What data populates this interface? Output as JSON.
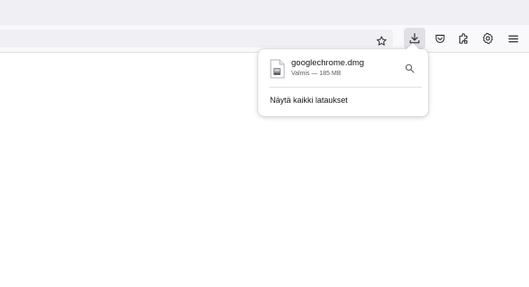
{
  "toolbar": {
    "icons": [
      "star-icon",
      "download-icon",
      "pocket-icon",
      "extensions-icon",
      "settings-icon",
      "menu-icon"
    ]
  },
  "downloads_panel": {
    "items": [
      {
        "file_name": "googlechrome.dmg",
        "status": "Valmis — 185 MB",
        "file_icon": "dmg-file-icon",
        "action_icon": "search-icon"
      }
    ],
    "show_all_label": "Näytä kaikki lataukset"
  },
  "colors": {
    "tab_strip_bg": "#f0f0f4",
    "nav_bar_bg": "#f9f9fb",
    "active_button_bg": "#e0e0e6",
    "icon_color": "#5b5b66",
    "text_color": "#15141a"
  }
}
